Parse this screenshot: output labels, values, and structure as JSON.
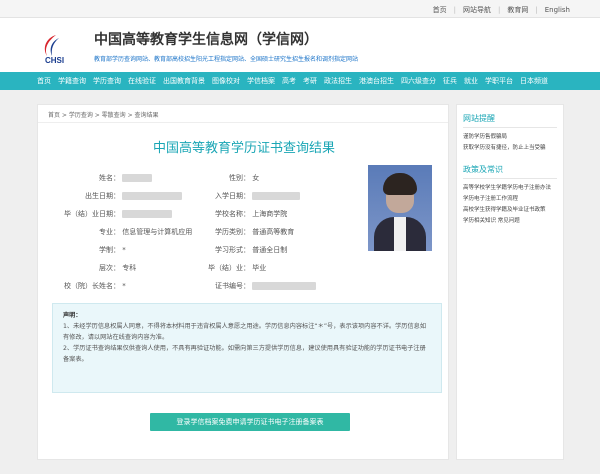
{
  "toplinks": [
    "首页",
    "网站导航",
    "教育网",
    "English"
  ],
  "site": {
    "title": "中国高等教育学生信息网（学信网）",
    "logo_text": "CHSI",
    "desc": "教育部学历查询网站、教育部高校招生阳光工程指定网站、全国硕士研究生招生报名和调剂指定网站"
  },
  "nav": [
    "首页",
    "学籍查询",
    "学历查询",
    "在线验证",
    "出国教育背景",
    "图像校对",
    "学信档案",
    "高考",
    "考研",
    "政法招生",
    "港澳台招生",
    "四六级查分",
    "征兵",
    "就业",
    "学职平台",
    "日本频道"
  ],
  "breadcrumb": "首页 > 学历查询 > 零散查询 > 查询结果",
  "result_title": "中国高等教育学历证书查询结果",
  "labels": {
    "name": "姓名：",
    "gender": "性别：",
    "birth": "出生日期：",
    "entry": "入学日期：",
    "grad_date": "毕（结）业日期：",
    "school": "学校名称：",
    "major": "专业：",
    "edu_type": "学历类别：",
    "level": "学制：",
    "form": "学习形式：",
    "tier": "层次：",
    "status": "毕（结）业：",
    "principal": "校（院）长姓名：",
    "cert_no": "证书编号："
  },
  "values": {
    "gender": "女",
    "school": "上海商学院",
    "major": "信息管理与计算机应用",
    "edu_type": "普通高等教育",
    "level": "*",
    "form": "普通全日制",
    "tier": "专科",
    "status": "毕业",
    "principal": "*"
  },
  "notice": {
    "title": "声明：",
    "p1": "1、未经学历信息权属人同意，不得将本材料用于违背权属人意愿之用途。学历信息内容标注“＊”号，表示该项内容不详。学历信息如有修改，请以网站在线查询内容为准。",
    "p2": "2、学历证书查询结果仅供查询人使用，不具有再验证功能。如需向第三方提供学历信息，建议使用具有验证功能的学历证书电子注册备案表。"
  },
  "button": "登录学信档案免费申请学历证书电子注册备案表",
  "sidebar": {
    "section1": "网站提醒",
    "items1": [
      "谨防学历售假骗局",
      "获取学历没有捷径，防止上当受骗"
    ],
    "section2": "政策及常识",
    "items2": [
      "高等学校学生学籍学历电子注册办法",
      "学历电子注册工作流程",
      "高校学生获得学籍及毕业证书政策",
      "学历相关知识  常见问题"
    ]
  }
}
